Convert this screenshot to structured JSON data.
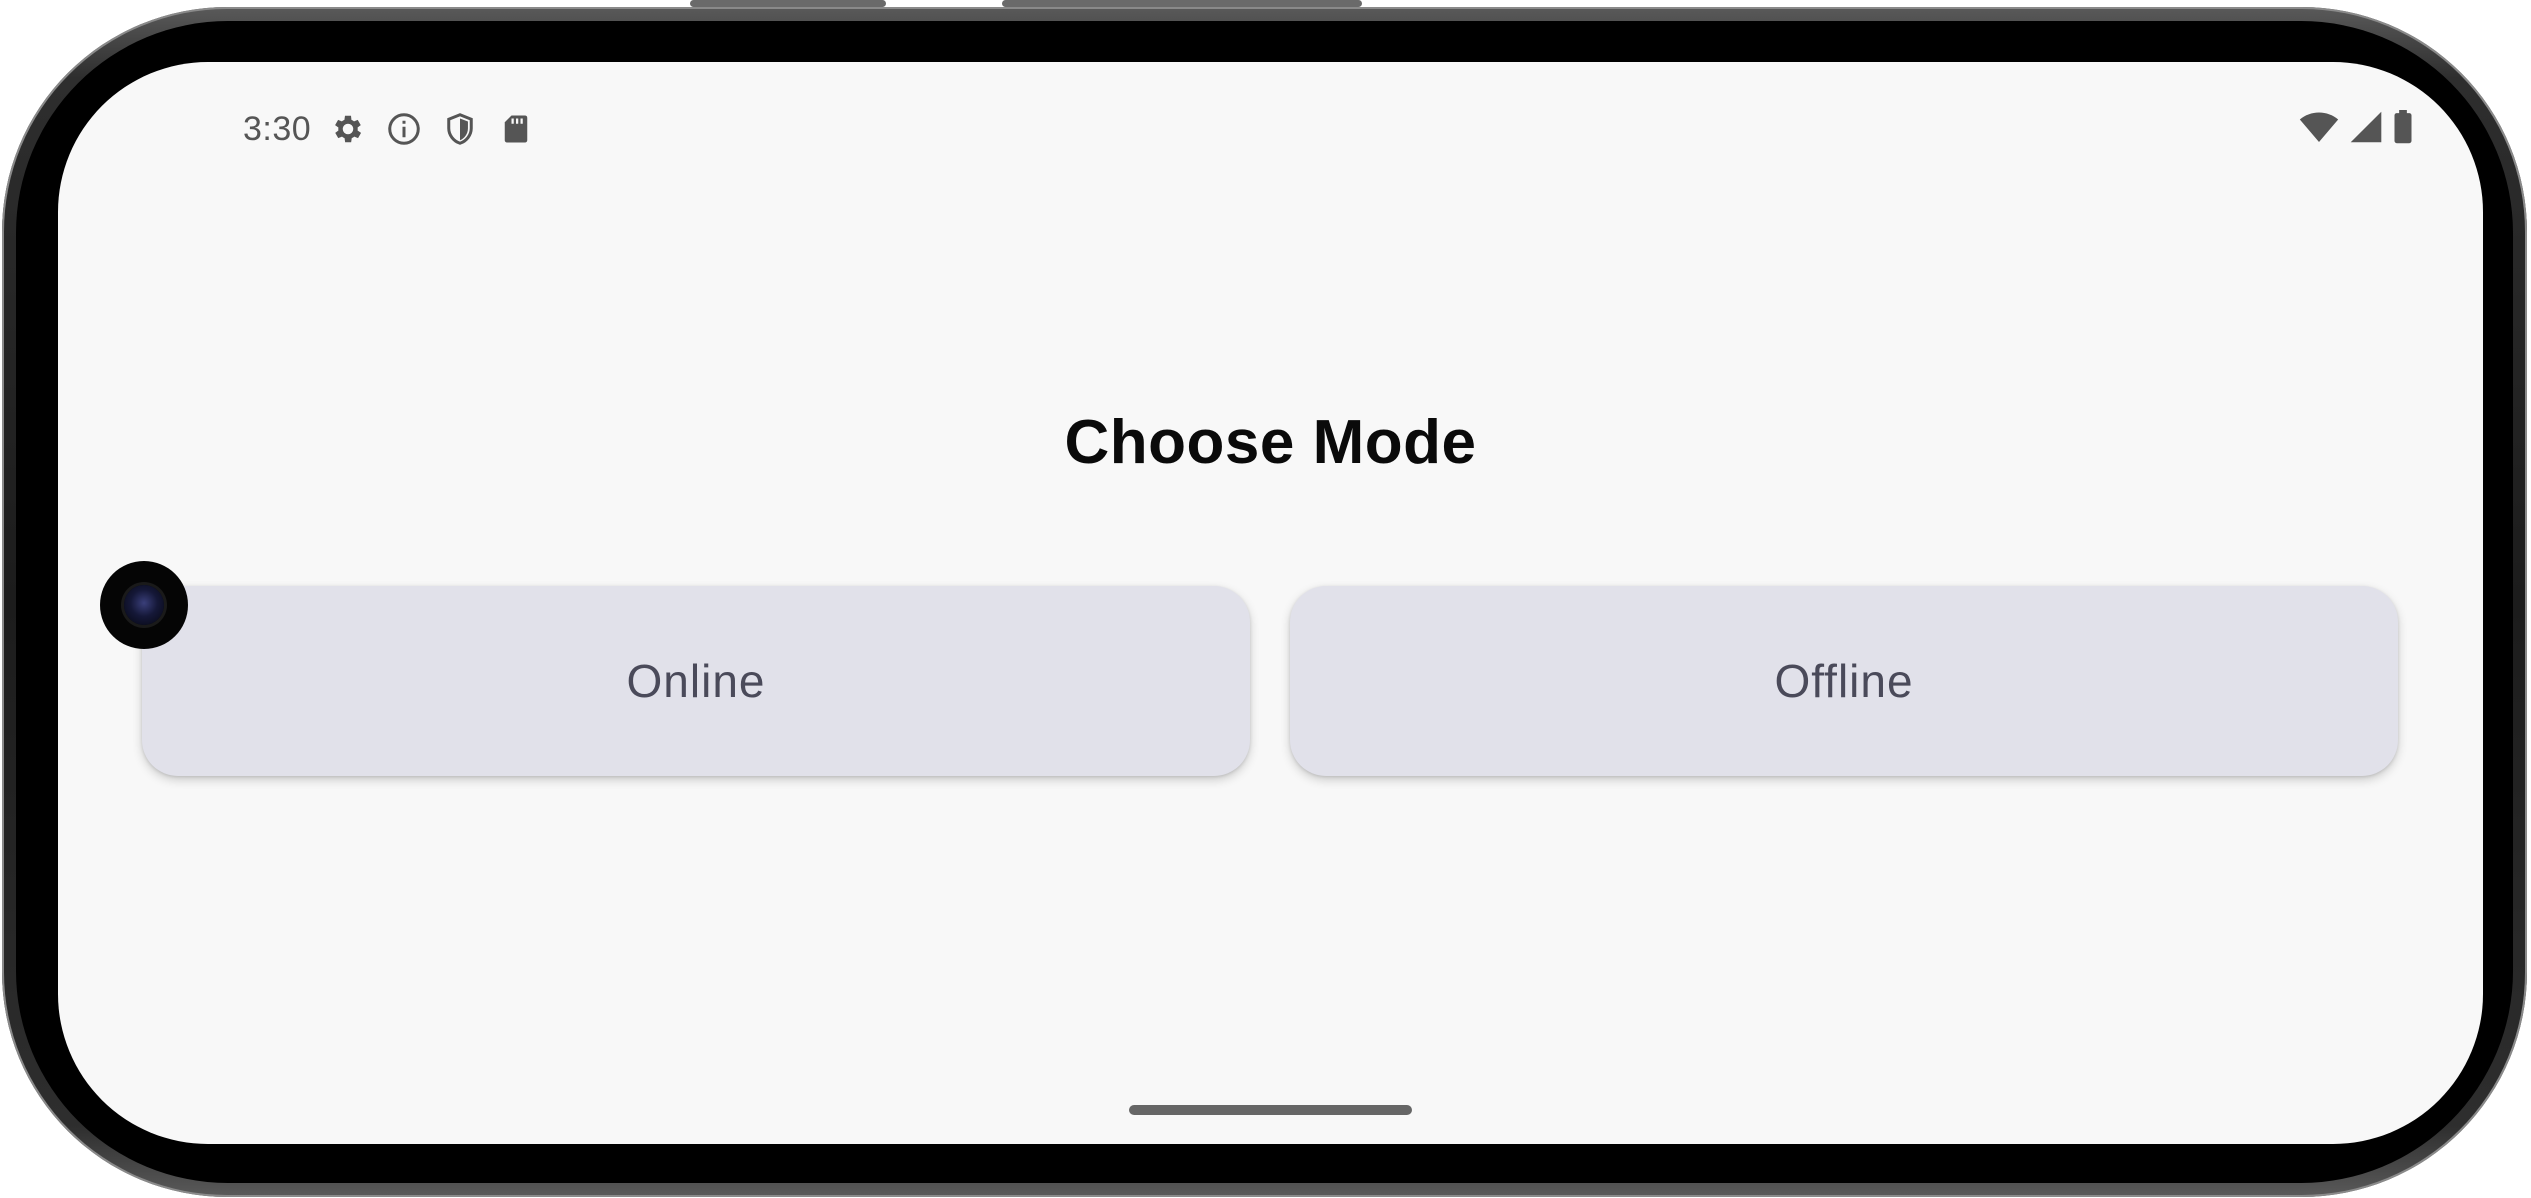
{
  "status_bar": {
    "time": "3:30",
    "left_icons": [
      "gear-icon",
      "info-icon",
      "shield-icon",
      "sd-card-icon"
    ],
    "right_icons": [
      "wifi-icon",
      "cell-signal-icon",
      "battery-icon"
    ]
  },
  "screen": {
    "title": "Choose Mode",
    "buttons": {
      "online": "Online",
      "offline": "Offline"
    }
  },
  "colors": {
    "background": "#f8f8f8",
    "button_bg": "#e1e1ea",
    "button_text": "#4a4a5a",
    "title_text": "#0a0a0a",
    "status_icon": "#555555"
  }
}
